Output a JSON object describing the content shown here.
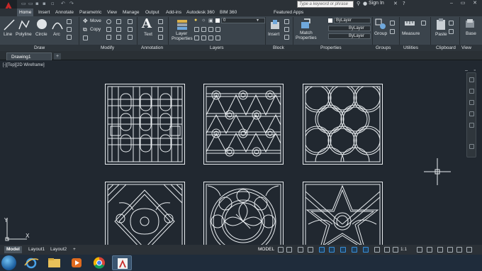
{
  "titlebar": {
    "search_placeholder": "Type a keyword or phrase",
    "signin_label": "Sign In"
  },
  "ribbon_tabs": [
    "Home",
    "Insert",
    "Annotate",
    "Parametric",
    "View",
    "Manage",
    "Output",
    "Add-ins",
    "Autodesk 360",
    "BIM 360",
    "Featured Apps"
  ],
  "draw": {
    "line": "Line",
    "polyline": "Polyline",
    "circle": "Circle",
    "arc": "Arc"
  },
  "modify": {
    "move": "Move",
    "copy": "Copy"
  },
  "annotation": {
    "text": "Text"
  },
  "layers": {
    "layer_properties_line1": "Layer",
    "layer_properties_line2": "Properties",
    "current_layer": "0"
  },
  "block": {
    "insert": "Insert"
  },
  "properties": {
    "match_line1": "Match",
    "match_line2": "Properties",
    "color": "ByLayer",
    "linetype": "ByLayer",
    "lineweight": "ByLayer"
  },
  "groups": {
    "group": "Group"
  },
  "utilities": {
    "measure": "Measure"
  },
  "clipboard": {
    "paste": "Paste"
  },
  "view": {
    "base": "Base"
  },
  "panel_labels": [
    "Draw",
    "Modify",
    "Annotation",
    "Layers",
    "Block",
    "Properties",
    "Groups",
    "Utilities",
    "Clipboard",
    "View"
  ],
  "document": {
    "tab_name": "Drawing1"
  },
  "viewport": {
    "label": "[-][Top][2D Wireframe]"
  },
  "layout_tabs": [
    "Model",
    "Layout1",
    "Layout2"
  ],
  "status": {
    "model": "MODEL",
    "scale": "1:1"
  },
  "colors": {
    "canvas": "#212830",
    "ribbon": "#3b444c",
    "accent": "#c62828",
    "linework": "#e8ecef"
  }
}
